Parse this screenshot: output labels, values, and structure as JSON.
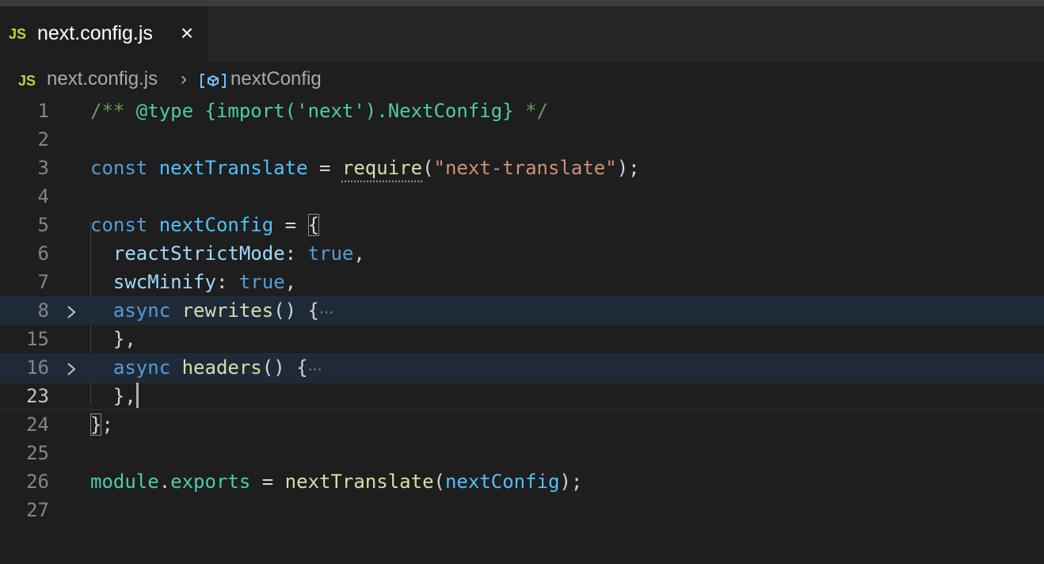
{
  "tab": {
    "badge": "JS",
    "title": "next.config.js",
    "close_glyph": "×"
  },
  "breadcrumb": {
    "badge": "JS",
    "file": "next.config.js",
    "separator": "›",
    "symbol_icon": "variable-symbol-icon",
    "symbol": "nextConfig"
  },
  "editor": {
    "current_line": "23",
    "folded_lines": [
      "8",
      "16"
    ],
    "line_numbers": [
      "1",
      "2",
      "3",
      "4",
      "5",
      "6",
      "7",
      "8",
      "15",
      "16",
      "23",
      "24",
      "25",
      "26",
      "27"
    ],
    "tokens": {
      "l1_comment_open": "/** ",
      "l1_tag": "@type",
      "l1_type": "{import('next').NextConfig}",
      "l1_comment_close": " */",
      "l3_const": "const",
      "l3_name": "nextTranslate",
      "l3_eq": " = ",
      "l3_require": "require",
      "l3_open": "(",
      "l3_string": "\"next-translate\"",
      "l3_close": ");",
      "l5_const": "const",
      "l5_name": "nextConfig",
      "l5_eq": " = ",
      "l5_brace": "{",
      "l6_prop": "reactStrictMode",
      "l6_colon": ": ",
      "l6_val": "true",
      "l6_comma": ",",
      "l7_prop": "swcMinify",
      "l7_colon": ": ",
      "l7_val": "true",
      "l7_comma": ",",
      "l8_async": "async",
      "l8_fn": "rewrites",
      "l8_rest": "() {",
      "l8_ellipsis": "⋯",
      "l15_close": "},",
      "l16_async": "async",
      "l16_fn": "headers",
      "l16_rest": "() {",
      "l16_ellipsis": "⋯",
      "l23_close": "},",
      "l24_brace": "}",
      "l24_semi": ";",
      "l26_module": "module",
      "l26_dot": ".",
      "l26_exports": "exports",
      "l26_eq": " = ",
      "l26_fn": "nextTranslate",
      "l26_open": "(",
      "l26_arg": "nextConfig",
      "l26_close": ");"
    }
  },
  "colors": {
    "background": "#1e1e1e",
    "tabbar": "#252526",
    "js_badge": "#cbcb41",
    "keyword": "#569cd6",
    "string": "#ce9178",
    "comment": "#6a9955",
    "function": "#dcdcaa",
    "property": "#9cdcfe",
    "folded_highlight": "#1f2a39"
  }
}
